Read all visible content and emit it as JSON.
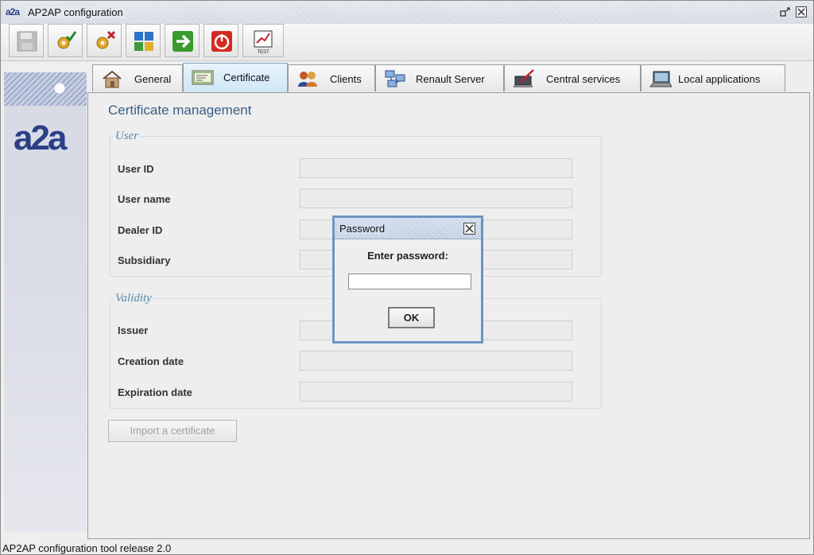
{
  "window": {
    "title": "AP2AP configuration",
    "app_icon_text": "a2a"
  },
  "toolbar": {
    "buttons": [
      {
        "name": "save",
        "icon": "floppy-disk-icon",
        "enabled": false
      },
      {
        "name": "validate",
        "icon": "gear-check-icon"
      },
      {
        "name": "cancel",
        "icon": "gear-cross-icon"
      },
      {
        "name": "table",
        "icon": "grid-icon"
      },
      {
        "name": "go",
        "icon": "arrow-right-icon",
        "color": "#3a9a2e"
      },
      {
        "name": "quit",
        "icon": "power-icon",
        "color": "#d32b22"
      },
      {
        "name": "test",
        "icon": "test-chart-icon",
        "label": "TEST"
      }
    ]
  },
  "sidebar": {
    "brand_text": "a2a"
  },
  "tabs": [
    {
      "label": "General",
      "icon": "house-icon",
      "active": false
    },
    {
      "label": "Certificate",
      "icon": "certificate-icon",
      "active": true
    },
    {
      "label": "Clients",
      "icon": "users-icon",
      "active": false
    },
    {
      "label": "Renault Server",
      "icon": "network-icon",
      "active": false
    },
    {
      "label": "Central services",
      "icon": "pen-laptop-icon",
      "active": false
    },
    {
      "label": "Local applications",
      "icon": "laptop-icon",
      "active": false
    }
  ],
  "certificate": {
    "title": "Certificate management",
    "user_group": {
      "legend": "User",
      "fields": [
        {
          "label": "User ID",
          "value": ""
        },
        {
          "label": "User name",
          "value": ""
        },
        {
          "label": "Dealer ID",
          "value": ""
        },
        {
          "label": "Subsidiary",
          "value": ""
        }
      ]
    },
    "validity_group": {
      "legend": "Validity",
      "fields": [
        {
          "label": "Issuer",
          "value": ""
        },
        {
          "label": "Creation date",
          "value": ""
        },
        {
          "label": "Expiration date",
          "value": ""
        }
      ]
    },
    "import_button": "Import a certificate"
  },
  "dialog": {
    "title": "Password",
    "prompt": "Enter password:",
    "input_value": "",
    "ok_label": "OK"
  },
  "status": {
    "text": "AP2AP configuration tool release 2.0"
  },
  "colors": {
    "accent": "#6d94c3",
    "title_text": "#3a5f86",
    "brand": "#2a3f86"
  }
}
